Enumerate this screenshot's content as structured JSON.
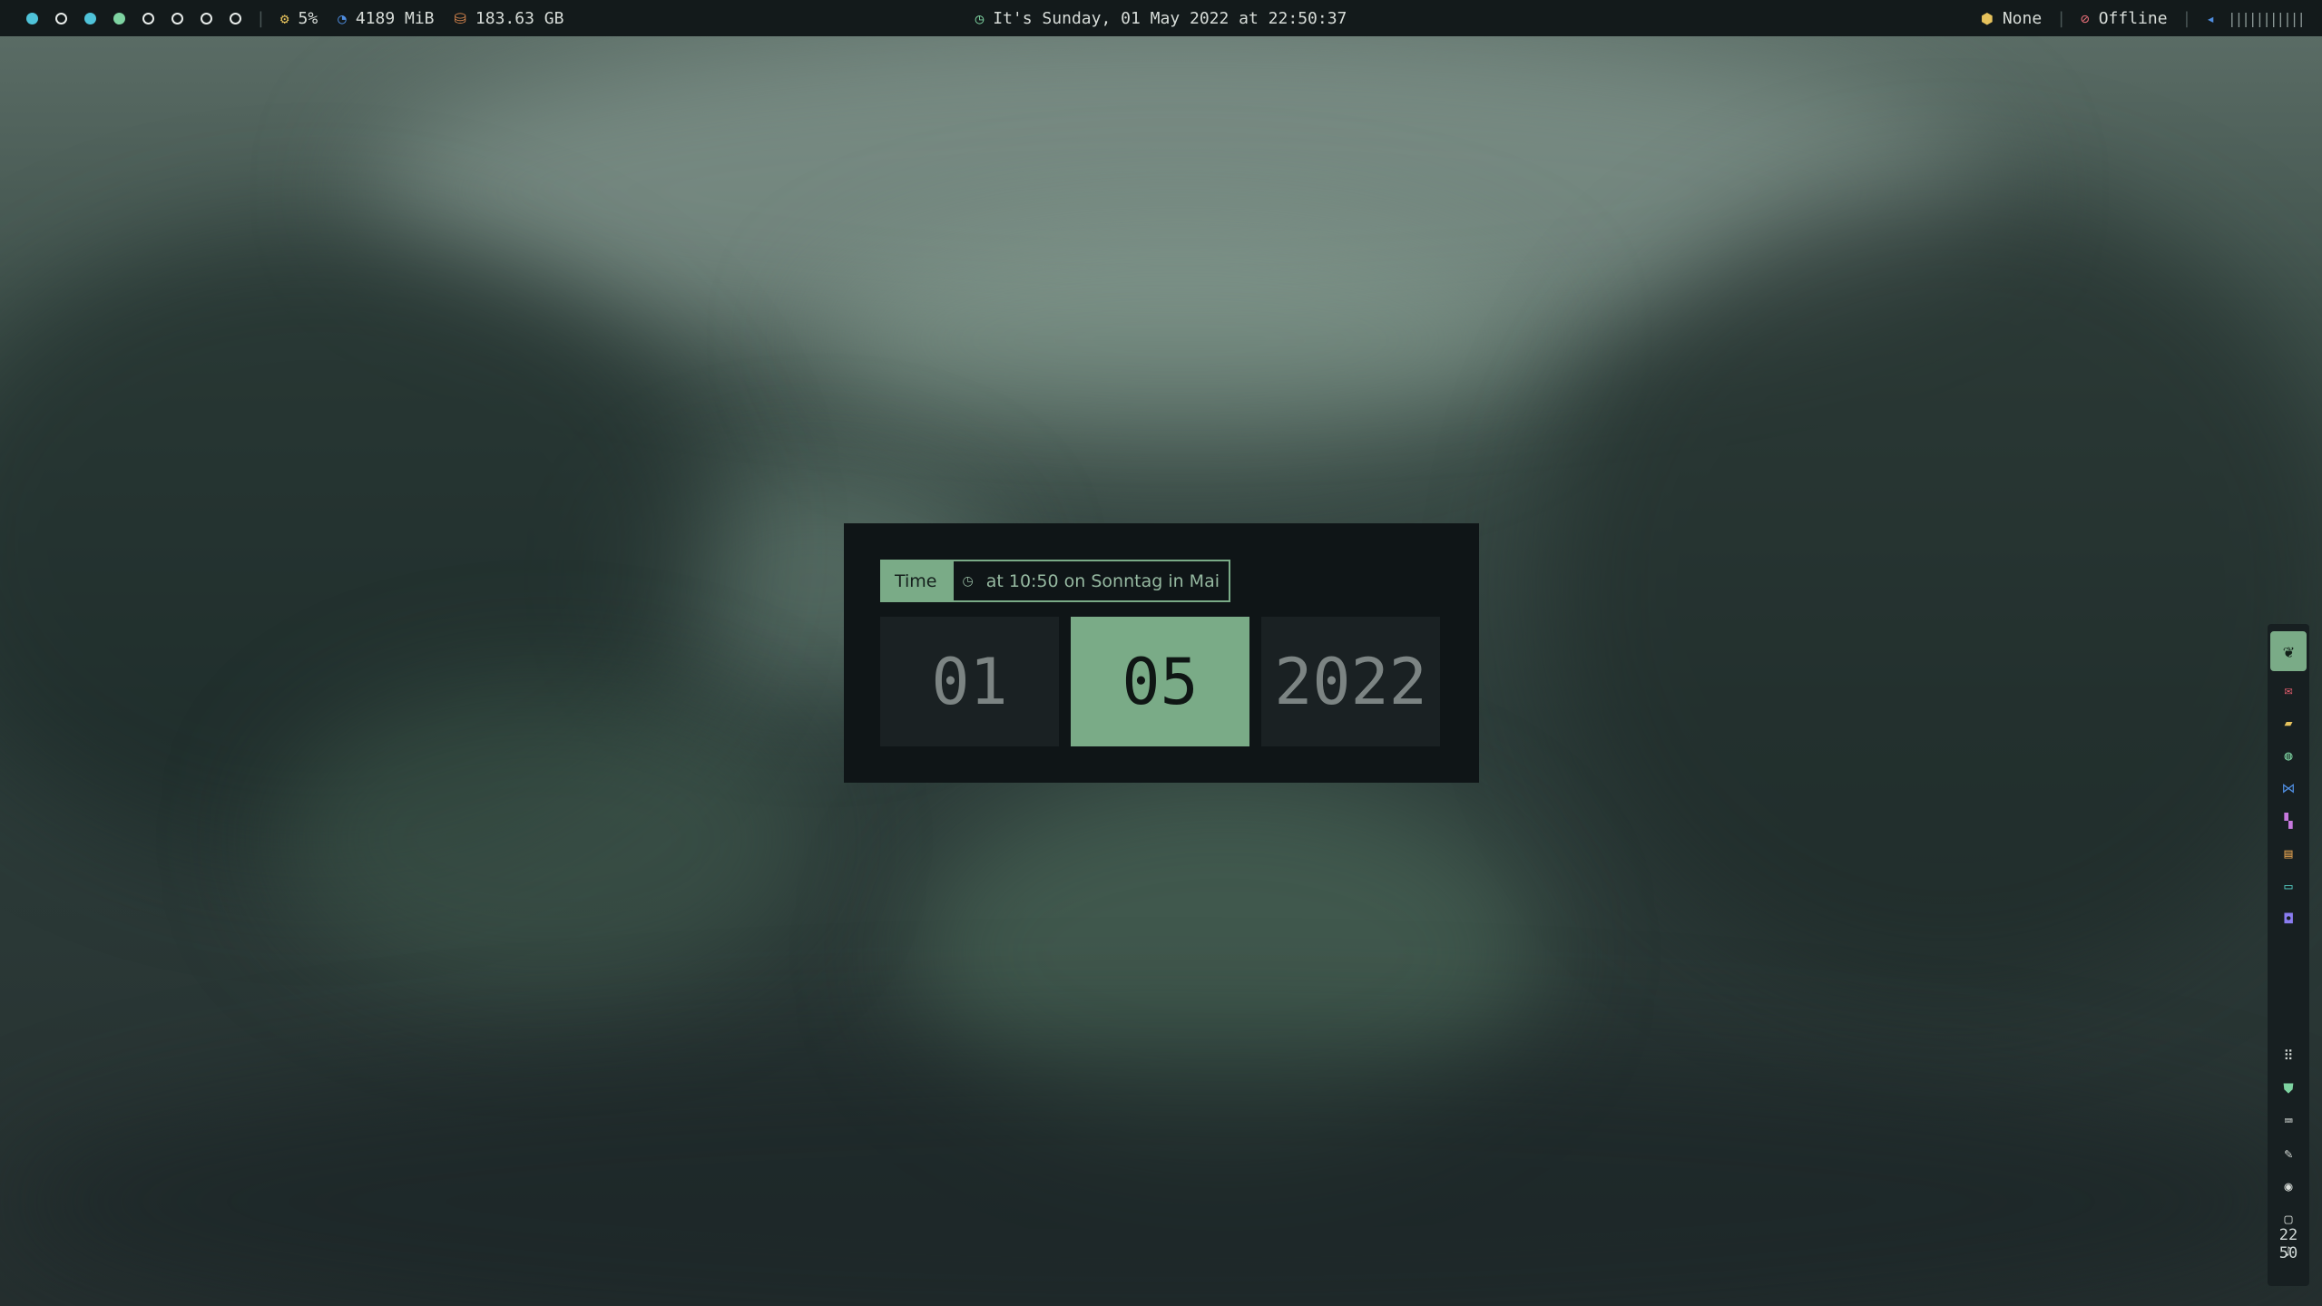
{
  "topbar": {
    "workspaces": [
      {
        "state": "filled"
      },
      {
        "state": "empty"
      },
      {
        "state": "filled"
      },
      {
        "state": "green"
      },
      {
        "state": "empty"
      },
      {
        "state": "empty"
      },
      {
        "state": "empty"
      },
      {
        "state": "empty"
      }
    ],
    "cpu": {
      "icon": "cpu-icon",
      "value": "5%",
      "color": "#e6c25c"
    },
    "memory": {
      "icon": "memory-icon",
      "value": "4189 MiB",
      "color": "#4f8de0"
    },
    "disk": {
      "icon": "disk-icon",
      "value": "183.63 GB",
      "color": "#e08a4f"
    },
    "clock": {
      "icon": "clock-icon",
      "text": "It's Sunday, 01 May 2022 at 22:50:37",
      "color": "#7ed3a1"
    },
    "media": {
      "icon": "package-icon",
      "value": "None",
      "color": "#e6c25c"
    },
    "network": {
      "icon": "offline-icon",
      "value": "Offline",
      "color": "#e06c75"
    },
    "volume": {
      "icon": "speaker-icon",
      "bar": "|||||||||||",
      "color": "#4f8de0"
    }
  },
  "widget": {
    "label": "Time",
    "icon": "clock-icon",
    "value": "at 10:50  on Sonntag in Mai",
    "day": "01",
    "month": "05",
    "year": "2022",
    "accent": "#7aab87"
  },
  "dock": {
    "items": [
      {
        "name": "leaf-icon",
        "glyph": "❦",
        "color": "#132019"
      },
      {
        "name": "mail-icon",
        "glyph": "✉",
        "color": "#e05c6c"
      },
      {
        "name": "folder-icon",
        "glyph": "▰",
        "color": "#e6c25c"
      },
      {
        "name": "globe-icon",
        "glyph": "◍",
        "color": "#7ed3a1"
      },
      {
        "name": "vscode-icon",
        "glyph": "⋈",
        "color": "#4f8de0"
      },
      {
        "name": "jetbrains-icon",
        "glyph": "▚",
        "color": "#c678dd"
      },
      {
        "name": "notes-icon",
        "glyph": "▤",
        "color": "#e0a04f"
      },
      {
        "name": "terminal-icon",
        "glyph": "▭",
        "color": "#56d3c9"
      },
      {
        "name": "discord-icon",
        "glyph": "◘",
        "color": "#8a7cf0"
      }
    ],
    "tray": [
      {
        "name": "app-grid-icon",
        "glyph": "⠿",
        "color": "#d7dcd8"
      },
      {
        "name": "shield-icon",
        "glyph": "⛊",
        "color": "#7ed3a1"
      },
      {
        "name": "keyboard-icon",
        "glyph": "⌨",
        "color": "#d7dcd8"
      },
      {
        "name": "brush-icon",
        "glyph": "✎",
        "color": "#d7dcd8"
      },
      {
        "name": "gamepad-icon",
        "glyph": "◉",
        "color": "#d7dcd8"
      },
      {
        "name": "monitor-icon",
        "glyph": "▢",
        "color": "#d7dcd8"
      },
      {
        "name": "volume-icon",
        "glyph": "♪",
        "color": "#d7dcd8"
      }
    ],
    "clock_hour": "22",
    "clock_minute": "50"
  }
}
